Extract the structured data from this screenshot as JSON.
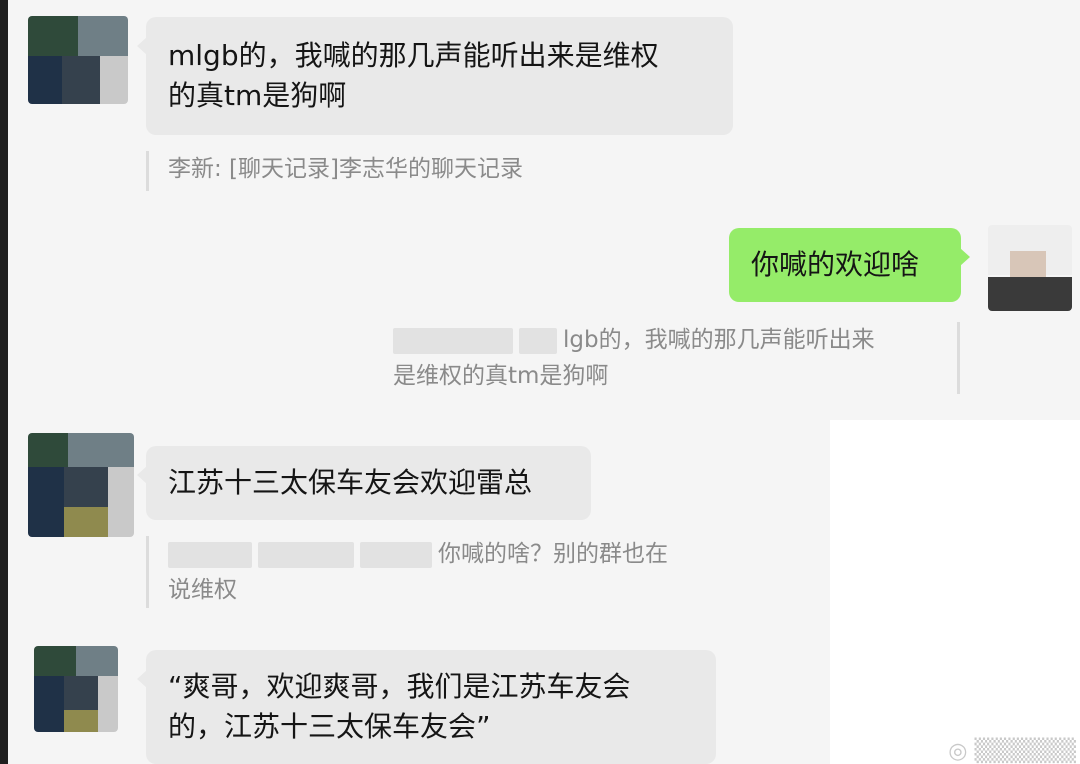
{
  "messages": [
    {
      "side": "left",
      "lines": [
        "mlgb的，我喊的那几声能听出来是维权",
        "的真tm是狗啊"
      ]
    },
    {
      "side": "right",
      "lines": [
        "你喊的欢迎啥"
      ]
    },
    {
      "side": "left",
      "lines": [
        "江苏十三太保车友会欢迎雷总"
      ]
    },
    {
      "side": "left",
      "lines": [
        "“爽哥，欢迎爽哥，我们是江苏车友会",
        "的，江苏十三太保车友会”"
      ]
    }
  ],
  "quotes": [
    {
      "lines": [
        "李新: [聊天记录]李志华的聊天记录"
      ]
    },
    {
      "lines": [
        "lgb的，我喊的那几声能听出来",
        "是维权的真tm是狗啊"
      ]
    },
    {
      "lines": [
        "你喊的啥？别的群也在",
        "说维权"
      ]
    }
  ],
  "colors": {
    "background": "#f5f5f5",
    "incoming_bubble": "#e9e9e9",
    "outgoing_bubble": "#95ec69",
    "quote_text": "#8a8a8a"
  }
}
